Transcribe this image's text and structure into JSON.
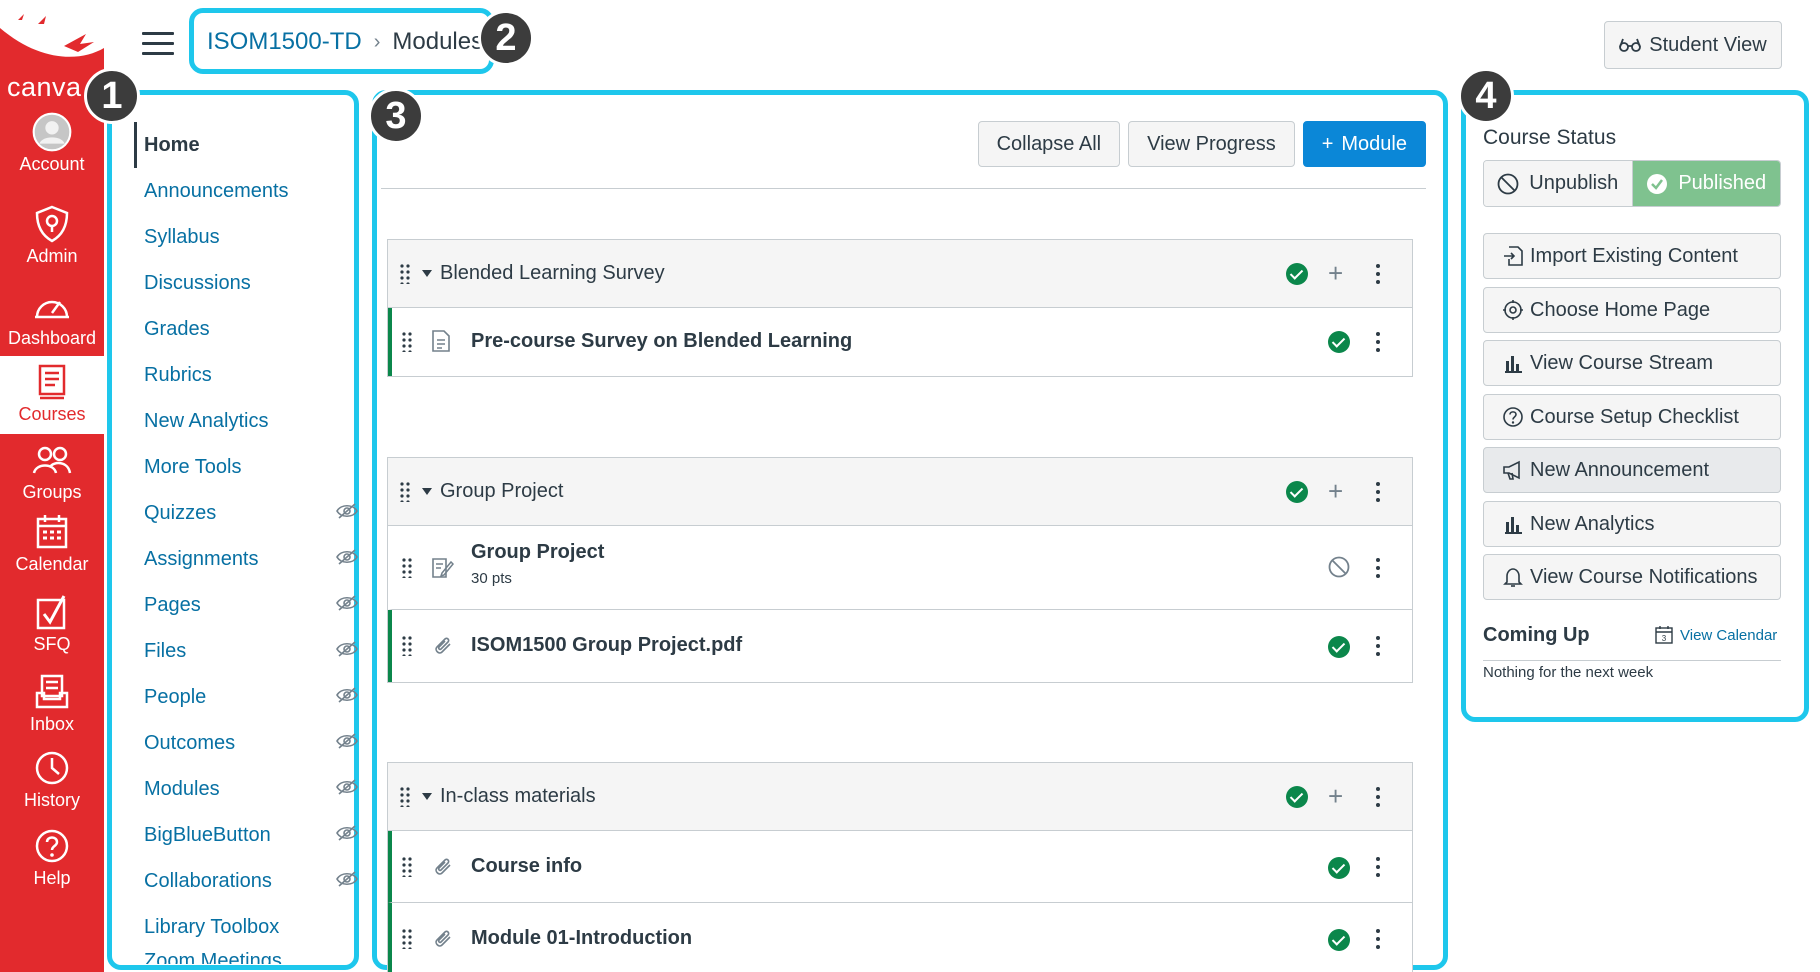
{
  "brand": {
    "text": "canva",
    "red": "#e22a2d",
    "link_blue": "#0770a3",
    "primary_blue": "#0b87d7",
    "success_green": "#0b874b",
    "highlight_cyan": "#1ec7ec"
  },
  "global_nav": [
    {
      "label": "Account",
      "icon": "avatar-icon"
    },
    {
      "label": "Admin",
      "icon": "shield-icon"
    },
    {
      "label": "Dashboard",
      "icon": "gauge-icon"
    },
    {
      "label": "Courses",
      "icon": "book-icon",
      "active": true
    },
    {
      "label": "Groups",
      "icon": "people-icon"
    },
    {
      "label": "Calendar",
      "icon": "calendar-icon"
    },
    {
      "label": "SFQ",
      "icon": "checkbox-icon"
    },
    {
      "label": "Inbox",
      "icon": "inbox-icon"
    },
    {
      "label": "History",
      "icon": "clock-icon"
    },
    {
      "label": "Help",
      "icon": "question-icon"
    }
  ],
  "header": {
    "breadcrumb": {
      "course": "ISOM1500-TD",
      "separator": "›",
      "current": "Modules"
    },
    "student_view": "Student View"
  },
  "badges": [
    "1",
    "2",
    "3",
    "4"
  ],
  "course_nav": [
    {
      "label": "Home",
      "active": true,
      "hidden": false
    },
    {
      "label": "Announcements",
      "hidden": false
    },
    {
      "label": "Syllabus",
      "hidden": false
    },
    {
      "label": "Discussions",
      "hidden": false
    },
    {
      "label": "Grades",
      "hidden": false
    },
    {
      "label": "Rubrics",
      "hidden": false
    },
    {
      "label": "New Analytics",
      "hidden": false
    },
    {
      "label": "More Tools",
      "hidden": false
    },
    {
      "label": "Quizzes",
      "hidden": true
    },
    {
      "label": "Assignments",
      "hidden": true
    },
    {
      "label": "Pages",
      "hidden": true
    },
    {
      "label": "Files",
      "hidden": true
    },
    {
      "label": "People",
      "hidden": true
    },
    {
      "label": "Outcomes",
      "hidden": true
    },
    {
      "label": "Modules",
      "hidden": true
    },
    {
      "label": "BigBlueButton",
      "hidden": true
    },
    {
      "label": "Collaborations",
      "hidden": true
    },
    {
      "label": "Library Toolbox",
      "hidden": false
    },
    {
      "label": "Zoom Meetings",
      "hidden": false
    }
  ],
  "toolbar": {
    "collapse_all": "Collapse All",
    "view_progress": "View Progress",
    "add_module": "Module",
    "add_module_prefix": "+"
  },
  "modules": [
    {
      "title": "Blended Learning Survey",
      "published": true,
      "items": [
        {
          "title": "Pre-course Survey on Blended Learning",
          "type": "page-icon",
          "published": true,
          "subtitle": ""
        }
      ]
    },
    {
      "title": "Group Project",
      "published": true,
      "items": [
        {
          "title": "Group Project",
          "type": "assignment-icon",
          "published": false,
          "subtitle": "30 pts"
        },
        {
          "title": "ISOM1500 Group Project.pdf",
          "type": "attachment-icon",
          "published": true,
          "subtitle": ""
        }
      ]
    },
    {
      "title": "In-class materials",
      "published": true,
      "items": [
        {
          "title": "Course info",
          "type": "attachment-icon",
          "published": true,
          "subtitle": ""
        },
        {
          "title": "Module 01-Introduction",
          "type": "attachment-icon",
          "published": true,
          "subtitle": ""
        }
      ]
    }
  ],
  "sidebar": {
    "course_status": "Course Status",
    "unpublish": "Unpublish",
    "published": "Published",
    "buttons": [
      {
        "label": "Import Existing Content",
        "icon": "import-icon"
      },
      {
        "label": "Choose Home Page",
        "icon": "target-icon"
      },
      {
        "label": "View Course Stream",
        "icon": "bar-chart-icon"
      },
      {
        "label": "Course Setup Checklist",
        "icon": "question-circle-icon"
      },
      {
        "label": "New Announcement",
        "icon": "megaphone-icon",
        "hover": true
      },
      {
        "label": "New Analytics",
        "icon": "bar-chart-icon"
      },
      {
        "label": "View Course Notifications",
        "icon": "bell-icon"
      }
    ],
    "coming_up": "Coming Up",
    "view_calendar": "View Calendar",
    "calendar_day": "3",
    "nothing": "Nothing for the next week"
  }
}
